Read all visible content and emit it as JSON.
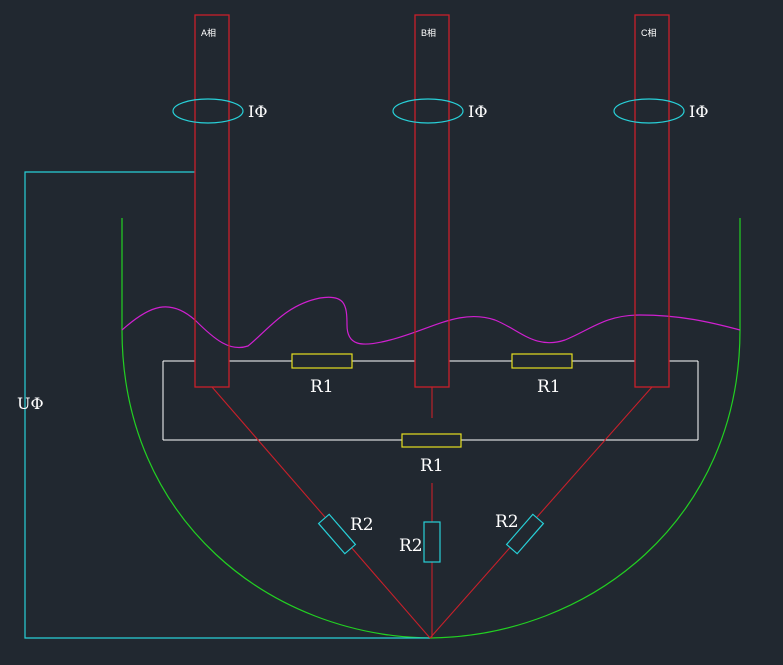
{
  "electrodes": [
    {
      "phase": "A相",
      "current": "IΦ"
    },
    {
      "phase": "B相",
      "current": "IΦ"
    },
    {
      "phase": "C相",
      "current": "IΦ"
    }
  ],
  "voltage_label": "UΦ",
  "resistors": {
    "r1_ab": "R1",
    "r1_bc": "R1",
    "r1_ca": "R1",
    "r2_a": "R2",
    "r2_b": "R2",
    "r2_c": "R2"
  },
  "colors": {
    "background": "#212830",
    "electrode": "#c8202a",
    "current_ring": "#28d0d8",
    "voltage_wire": "#28d0d8",
    "furnace": "#22d022",
    "melt_surface": "#d020d0",
    "r1": "#e6e020",
    "r2": "#28d0d8",
    "bus": "#ffffff"
  }
}
